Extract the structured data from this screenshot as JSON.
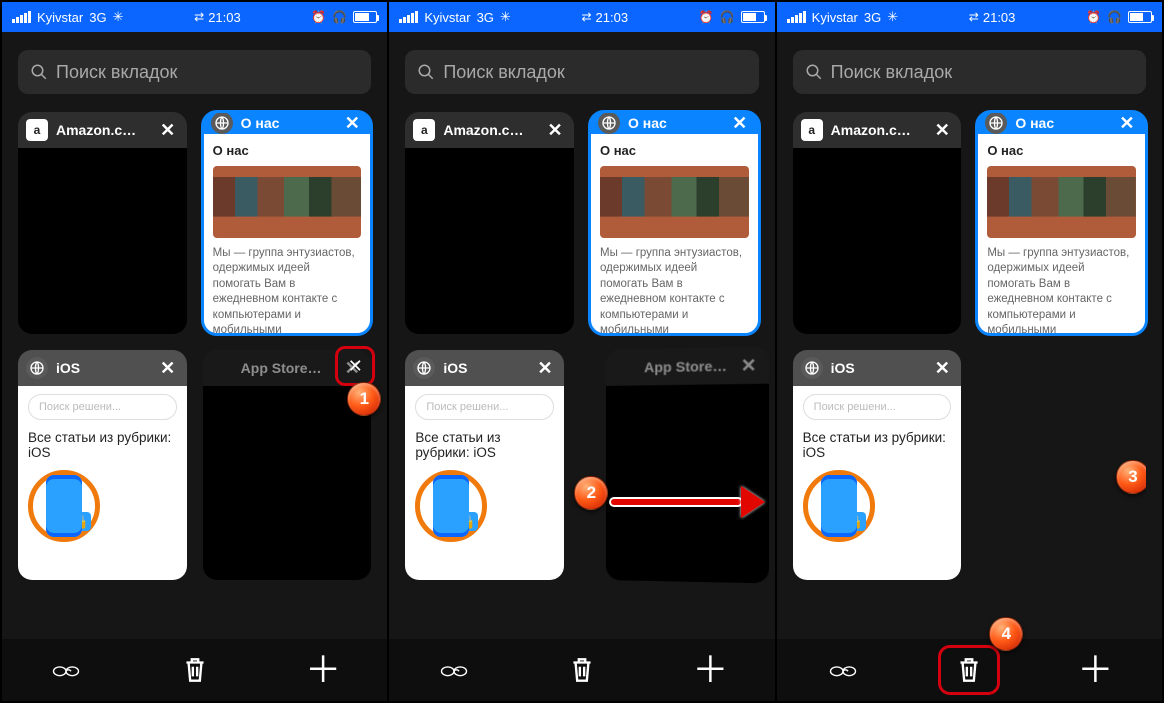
{
  "status": {
    "carrier": "Kyivstar",
    "network": "3G",
    "time": "21:03"
  },
  "search": {
    "placeholder": "Поиск вкладок"
  },
  "tabs": {
    "amazon": {
      "title": "Amazon.c…"
    },
    "about": {
      "title": "О нас",
      "heading": "О нас",
      "text": "Мы — группа энтузиастов, одержимых идеей помогать Вам в ежедневном контакте с компьютерами и мобильными устройствами. Мы знаем, что в интернете уже полно"
    },
    "ios": {
      "title": "iOS",
      "search_placeholder": "Поиск решени...",
      "heading": "Все статьи из рубрики: iOS"
    },
    "appstore": {
      "title": "App Store…"
    }
  },
  "steps": {
    "s1": "1",
    "s2": "2",
    "s3": "3",
    "s4": "4"
  }
}
